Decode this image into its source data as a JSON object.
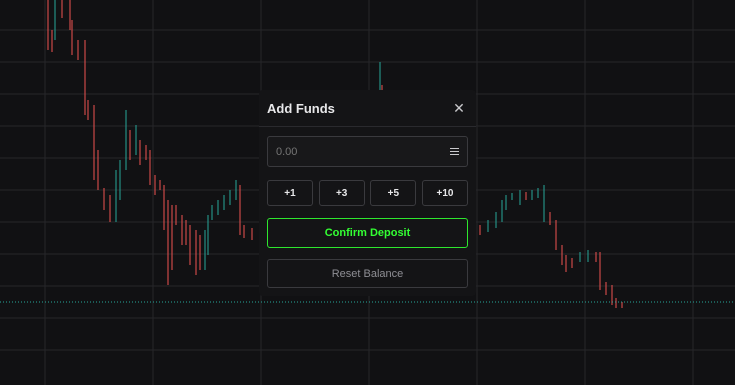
{
  "colors": {
    "background": "#111113",
    "grid": "#262629",
    "candle_up": "#26a69a",
    "candle_down": "#ef5350",
    "price_line": "#26a69a",
    "confirm_accent": "#33ff33"
  },
  "modal": {
    "title": "Add Funds",
    "close_icon": "close-icon",
    "amount_placeholder": "0.00",
    "amount_value": "",
    "menu_icon": "menu-icon",
    "quick_amounts": [
      "+1",
      "+3",
      "+5",
      "+10"
    ],
    "confirm_label": "Confirm Deposit",
    "reset_label": "Reset Balance"
  }
}
